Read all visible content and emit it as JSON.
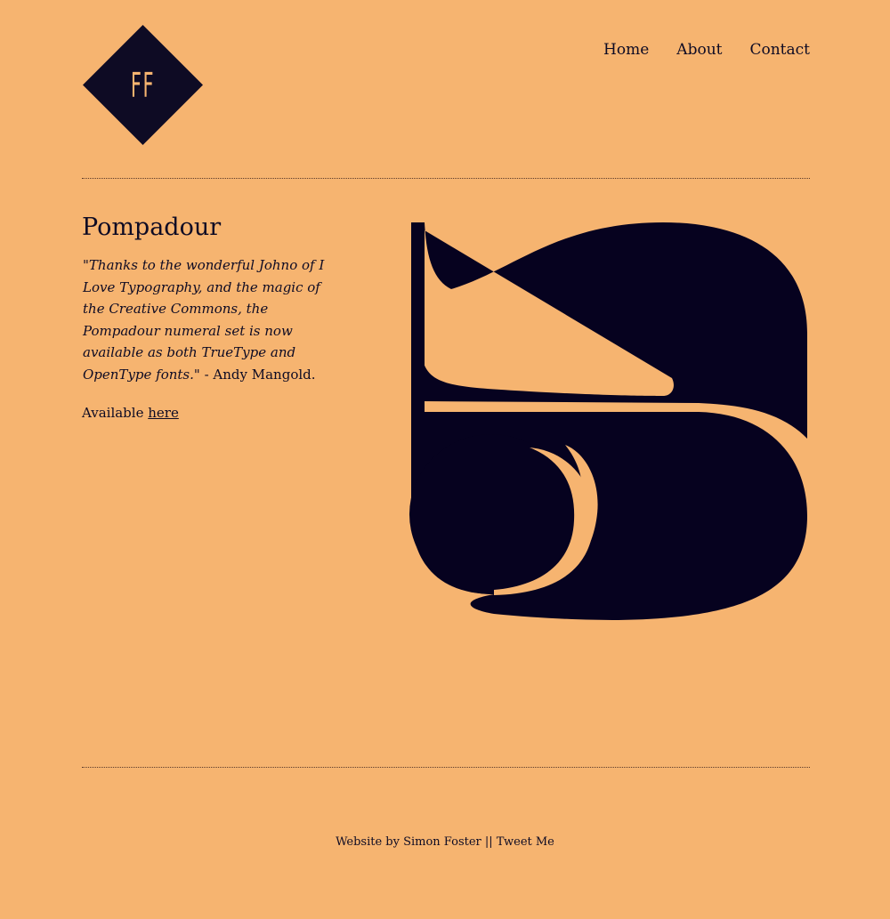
{
  "logo": {
    "text": "FF"
  },
  "nav": {
    "home": "Home",
    "about": "About",
    "contact": "Contact"
  },
  "article": {
    "title": "Pompadour",
    "quote": "\"Thanks to the wonderful Johno of I Love Typography, and the magic of the Creative Commons, the Pompadour numeral set is now available as both TrueType and OpenType fonts.\"",
    "attribution": " - Andy Mangold.",
    "available_prefix": "Available ",
    "available_link": "here"
  },
  "footer": {
    "credit": "Website by Simon Foster",
    "separator": "||",
    "tweet": "Tweet Me"
  },
  "colors": {
    "background": "#f6b470",
    "ink": "#0e0b24"
  }
}
